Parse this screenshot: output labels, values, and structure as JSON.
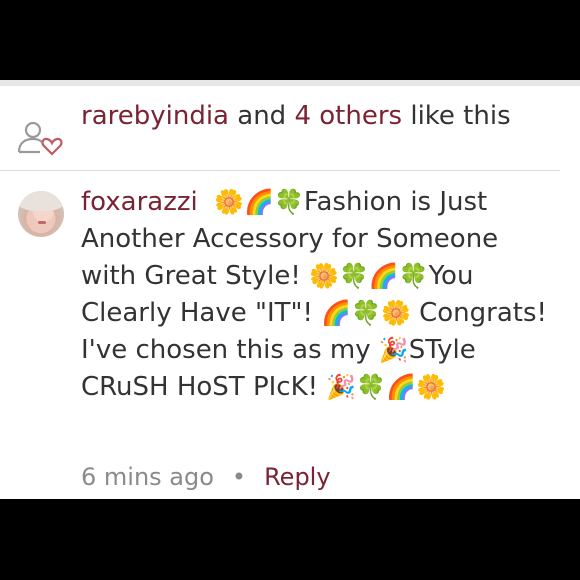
{
  "likes": {
    "user": "rarebyindia",
    "middle": " and ",
    "others": "4 others",
    "suffix": " like this"
  },
  "comment": {
    "username": "foxarazzi",
    "emoji_lead": "🌼🌈🍀",
    "text1": "Fashion is Just Another Accessory for Someone with Great Style! ",
    "emoji_mid1": "🌼🍀🌈🍀",
    "text2": "You Clearly Have \"IT\"! ",
    "emoji_mid2": "🌈🍀🌼",
    "text3": " Congrats! I've chosen this as my ",
    "emoji_mid3": "🎉",
    "text4": "STyle CRuSH HoST PIcK! ",
    "emoji_tail": "🎉🍀🌈🌼"
  },
  "meta": {
    "time": "6 mins ago",
    "separator": "•",
    "reply": "Reply"
  },
  "icons": {
    "likes_icon": "heart-person-icon",
    "accent": "#7a2333"
  }
}
